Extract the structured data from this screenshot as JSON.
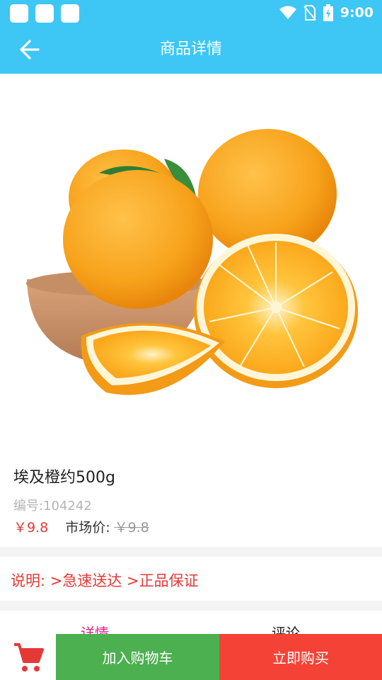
{
  "status_bar": {
    "time": "9:00",
    "icons": [
      "wifi-icon",
      "no-sim-icon",
      "battery-charging-icon"
    ],
    "notification_icons": [
      "notification-icon",
      "notification-icon",
      "notification-icon"
    ]
  },
  "app_bar": {
    "back_icon": "arrow-left-icon",
    "title": "商品详情",
    "background": "#3ec6f5"
  },
  "product": {
    "image": "orange-fruit-photo",
    "name": "埃及橙约500g",
    "code": "编号:104242",
    "price": "￥9.8",
    "market_label": "市场价:",
    "market_price": "￥9.8"
  },
  "description": "说明: >急速送达 >正品保证",
  "tabs": [
    {
      "label": "详情",
      "active": true
    },
    {
      "label": "评论",
      "active": false
    }
  ],
  "bottom_bar": {
    "cart_icon": "shopping-cart-icon",
    "add_to_cart": "加入购物车",
    "buy_now": "立即购买",
    "colors": {
      "add_to_cart": "#4caf50",
      "buy_now": "#f44336",
      "cart_icon": "#e53935"
    }
  }
}
